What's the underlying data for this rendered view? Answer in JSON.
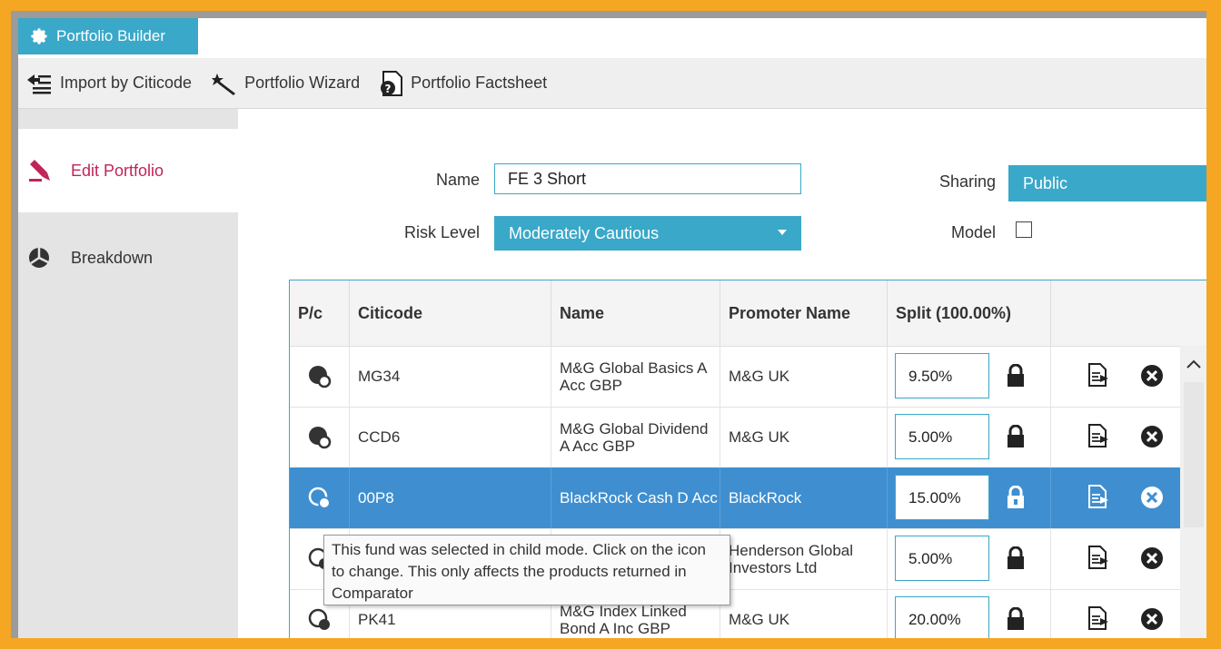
{
  "title": "Portfolio Builder",
  "toolbar": {
    "import": "Import by Citicode",
    "wizard": "Portfolio Wizard",
    "factsheet": "Portfolio Factsheet"
  },
  "sidebar": {
    "items": [
      {
        "label": "Edit Portfolio",
        "icon": "pencil-icon",
        "active": true
      },
      {
        "label": "Breakdown",
        "icon": "pie-chart-icon",
        "active": false
      }
    ]
  },
  "form": {
    "name_label": "Name",
    "name_value": "FE 3 Short",
    "risk_label": "Risk Level",
    "risk_value": "Moderately Cautious",
    "sharing_label": "Sharing",
    "sharing_value": "Public",
    "model_label": "Model",
    "model_checked": false
  },
  "table": {
    "headers": [
      "P/c",
      "Citicode",
      "Name",
      "Promoter Name",
      "Split (100.00%)",
      ""
    ],
    "rows": [
      {
        "mode": "parent",
        "citicode": "MG34",
        "name": "M&G Global Basics A Acc GBP",
        "promoter": "M&G UK",
        "split": "9.50%",
        "selected": false
      },
      {
        "mode": "parent",
        "citicode": "CCD6",
        "name": "M&G Global Dividend A Acc GBP",
        "promoter": "M&G UK",
        "split": "5.00%",
        "selected": false
      },
      {
        "mode": "child",
        "citicode": "00P8",
        "name": "BlackRock Cash D Acc",
        "promoter": "BlackRock",
        "split": "15.00%",
        "selected": true
      },
      {
        "mode": "child",
        "citicode": "",
        "name": "",
        "promoter": "Henderson Global Investors Ltd",
        "split": "5.00%",
        "selected": false
      },
      {
        "mode": "child",
        "citicode": "PK41",
        "name": "M&G Index Linked Bond A Inc GBP",
        "promoter": "M&G UK",
        "split": "20.00%",
        "selected": false
      }
    ]
  },
  "tooltip": "This fund was selected in child mode. Click on the icon to change. This only affects the products returned in Comparator",
  "colors": {
    "accent": "#3aa8c8",
    "selected_row": "#3f8fd0",
    "active_nav": "#c0245a",
    "frame": "#f5a623"
  }
}
